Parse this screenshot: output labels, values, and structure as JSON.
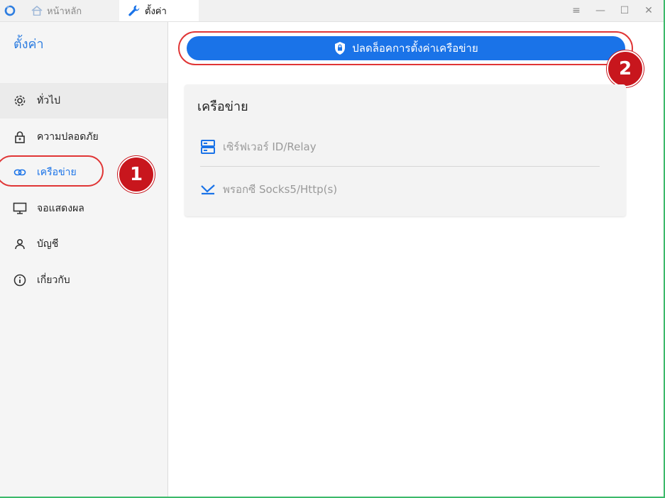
{
  "titlebar": {
    "tabs": [
      {
        "label": "หน้าหลัก",
        "icon": "home-icon"
      },
      {
        "label": "ตั้งค่า",
        "icon": "wrench-icon"
      }
    ],
    "controls": [
      "menu-icon",
      "minimize-icon",
      "maximize-icon",
      "close-icon"
    ]
  },
  "sidebar": {
    "title": "ตั้งค่า",
    "items": [
      {
        "label": "ทั่วไป",
        "icon": "gear-icon"
      },
      {
        "label": "ความปลอดภัย",
        "icon": "lock-icon"
      },
      {
        "label": "เครือข่าย",
        "icon": "link-icon",
        "active": true
      },
      {
        "label": "จอแสดงผล",
        "icon": "monitor-icon"
      },
      {
        "label": "บัญชี",
        "icon": "user-icon"
      },
      {
        "label": "เกี่ยวกับ",
        "icon": "info-icon"
      }
    ]
  },
  "annotations": {
    "step1": "1",
    "step2": "2"
  },
  "main": {
    "unlock_label": "ปลดล็อคการตั้งค่าเครือข่าย",
    "card": {
      "title": "เครือข่าย",
      "rows": [
        {
          "label": "เซิร์ฟเวอร์ ID/Relay",
          "icon": "server-icon"
        },
        {
          "label": "พรอกซี Socks5/Http(s)",
          "icon": "proxy-icon"
        }
      ]
    }
  },
  "colors": {
    "accent": "#1a73e8",
    "annotation_red": "#c8161d",
    "window_border": "#3cb96a"
  }
}
